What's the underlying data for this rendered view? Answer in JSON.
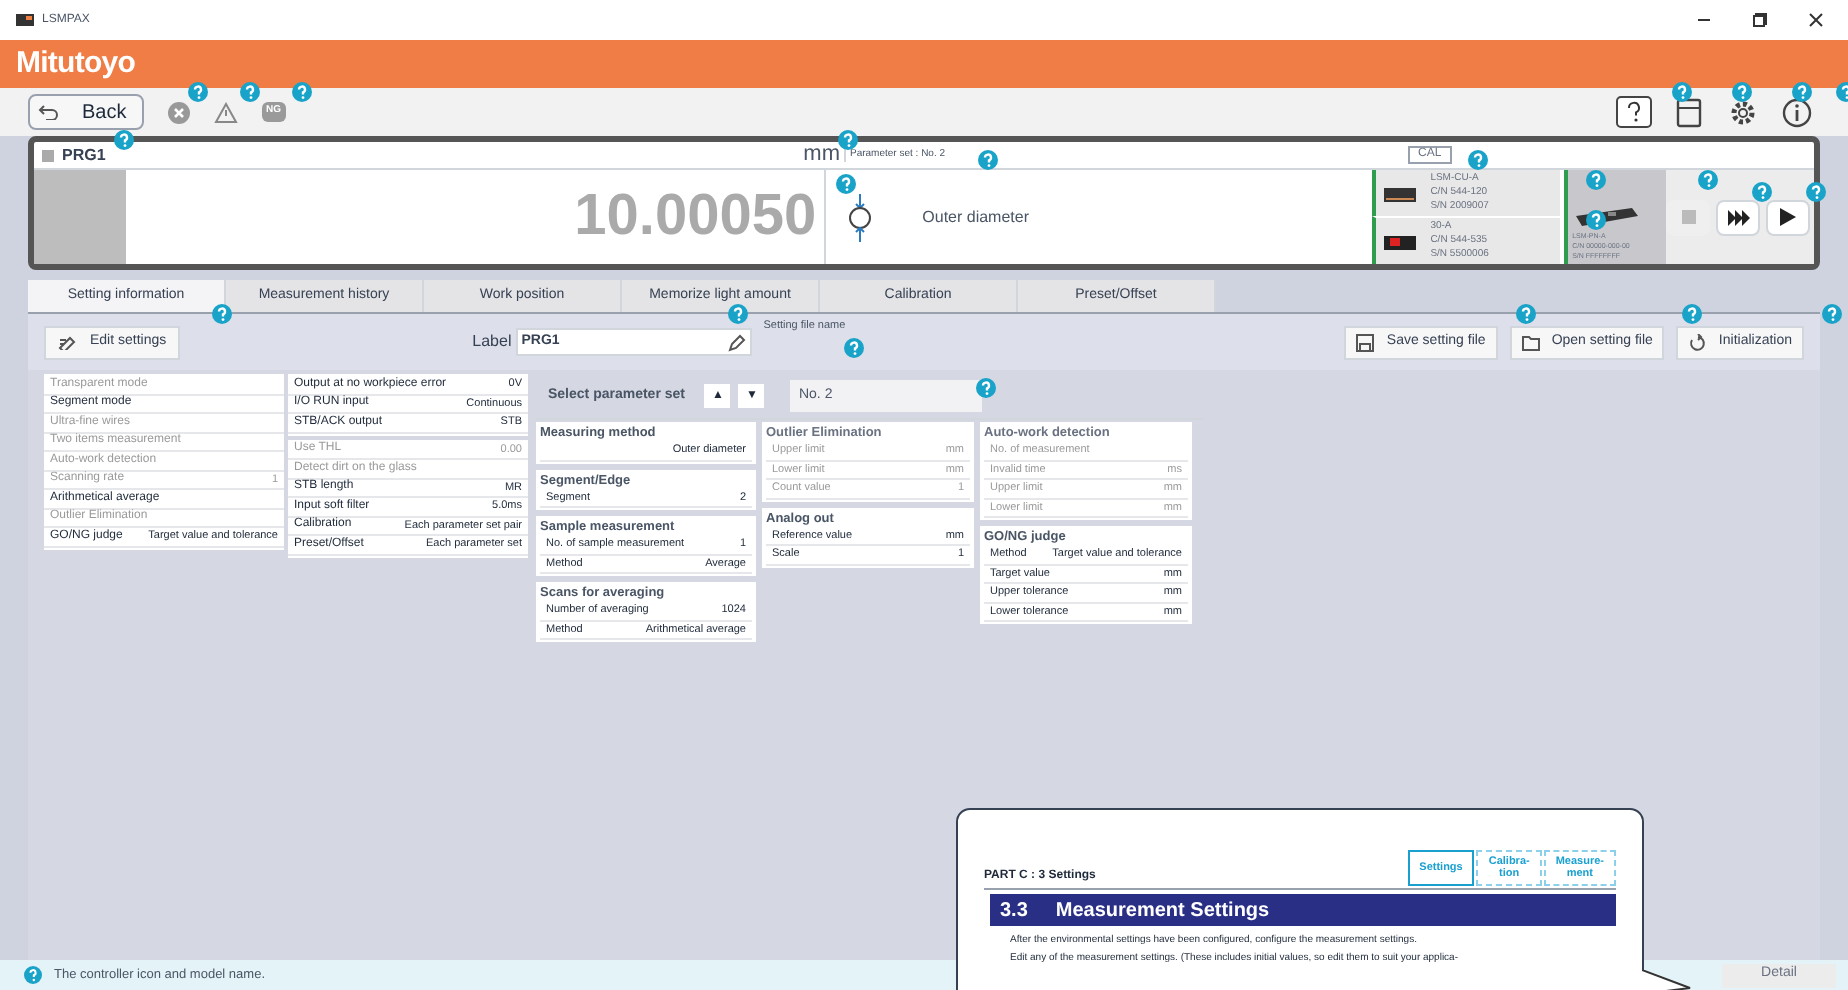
{
  "window": {
    "title": "LSMPAX"
  },
  "header": {
    "logo": "Mitutoyo"
  },
  "toolbar": {
    "back": "Back",
    "ng_badge": "NG"
  },
  "display": {
    "program": "PRG1",
    "unit": "mm",
    "parameter_set": "Parameter set : No. 2",
    "value": "10.00050",
    "method": "Outer diameter",
    "cal": "CAL",
    "devices": [
      {
        "lines": [
          "LSM-CU-A",
          "C/N 544-120",
          "S/N 2009007"
        ]
      },
      {
        "lines": [
          "30-A",
          "C/N 544-535",
          "S/N 5500006"
        ]
      }
    ],
    "head": {
      "lines": [
        "LSM-PN-A",
        "C/N 00000-000-00",
        "S/N FFFFFFFF"
      ]
    }
  },
  "tabs": [
    {
      "label": "Setting information",
      "selected": true
    },
    {
      "label": "Measurement history",
      "selected": false
    },
    {
      "label": "Work position",
      "selected": false
    },
    {
      "label": "Memorize light amount",
      "selected": false
    },
    {
      "label": "Calibration",
      "selected": false
    },
    {
      "label": "Preset/Offset",
      "selected": false
    }
  ],
  "actions": {
    "edit": "Edit settings",
    "label_caption": "Label",
    "label_value": "PRG1",
    "file_name_caption": "Setting file name",
    "buttons": [
      "Save setting file",
      "Open setting file",
      "Initialization"
    ]
  },
  "mode_panel": [
    {
      "label": "Transparent mode",
      "disabled": true
    },
    {
      "label": "Segment mode",
      "disabled": false
    },
    {
      "label": "Ultra-fine wires",
      "disabled": true
    },
    {
      "label": "Two items measurement",
      "disabled": true
    },
    {
      "label": "Auto-work detection",
      "disabled": true
    },
    {
      "label": "Scanning rate",
      "value": "1",
      "disabled": true
    },
    {
      "label": "Arithmetical average",
      "disabled": false
    },
    {
      "label": "Outlier Elimination",
      "disabled": true
    },
    {
      "label": "GO/NG judge",
      "value": "Target value and tolerance",
      "disabled": false
    }
  ],
  "io_panel": [
    {
      "label": "Output at no workpiece error",
      "value": "0V",
      "disabled": false
    },
    {
      "label": "I/O RUN input",
      "value": "Continuous",
      "disabled": false
    },
    {
      "label": "STB/ACK output",
      "value": "STB",
      "disabled": false
    }
  ],
  "threshold_panel": [
    {
      "label": "Use THL",
      "value": "0.00",
      "disabled": true
    },
    {
      "label": "Detect dirt on the glass",
      "disabled": true
    },
    {
      "label": "STB length",
      "value": "MR",
      "disabled": false
    },
    {
      "label": "Input soft filter",
      "value": "5.0ms",
      "disabled": false
    },
    {
      "label": "Calibration",
      "value": "Each parameter set pair",
      "disabled": false
    },
    {
      "label": "Preset/Offset",
      "value": "Each parameter set",
      "disabled": false
    }
  ],
  "parameter_set": {
    "caption": "Select parameter set",
    "up": "▲",
    "down": "▼",
    "value": "No. 2"
  },
  "columns": [
    [
      {
        "title": "Measuring method",
        "rows": [
          {
            "value": "Outer diameter",
            "disabled": false
          }
        ]
      },
      {
        "title": "Segment/Edge",
        "rows": [
          {
            "label": "Segment",
            "value": "2",
            "disabled": false
          }
        ]
      },
      {
        "title": "Sample measurement",
        "rows": [
          {
            "label": "No. of sample measurement",
            "value": "1",
            "disabled": false
          },
          {
            "label": "Method",
            "value": "Average",
            "disabled": false
          }
        ]
      },
      {
        "title": "Scans for averaging",
        "rows": [
          {
            "label": "Number of averaging",
            "value": "1024",
            "disabled": false
          },
          {
            "label": "Method",
            "value": "Arithmetical average",
            "disabled": false
          }
        ]
      }
    ],
    [
      {
        "title": "Outlier Elimination",
        "rows": [
          {
            "label": "Upper limit",
            "value": "mm",
            "disabled": true
          },
          {
            "label": "Lower limit",
            "value": "mm",
            "disabled": true
          },
          {
            "label": "Count value",
            "value": "1",
            "disabled": true
          }
        ]
      },
      {
        "title": "Analog out",
        "rows": [
          {
            "label": "Reference value",
            "value": "mm",
            "disabled": false
          },
          {
            "label": "Scale",
            "value": "1",
            "disabled": false
          }
        ]
      }
    ],
    [
      {
        "title": "Auto-work detection",
        "rows": [
          {
            "label": "No. of measurement",
            "disabled": true
          },
          {
            "label": "Invalid time",
            "value": "ms",
            "disabled": true
          },
          {
            "label": "Upper limit",
            "value": "mm",
            "disabled": true
          },
          {
            "label": "Lower limit",
            "value": "mm",
            "disabled": true
          }
        ]
      },
      {
        "title": "GO/NG judge",
        "rows": [
          {
            "label": "Method",
            "value": "Target value and tolerance",
            "disabled": false
          },
          {
            "label": "Target value",
            "value": "mm",
            "disabled": false
          },
          {
            "label": "Upper tolerance",
            "value": "mm",
            "disabled": false
          },
          {
            "label": "Lower tolerance",
            "value": "mm",
            "disabled": false
          }
        ]
      }
    ]
  ],
  "popup": {
    "header": "PART C : 3 Settings",
    "steps": [
      {
        "label": "Settings",
        "selected": true
      },
      {
        "label": "Calibra-\ntion",
        "selected": false
      },
      {
        "label": "Measure-\nment",
        "selected": false
      }
    ],
    "number": "3.3",
    "heading": "Measurement Settings",
    "lines": [
      "After the environmental settings have been configured, configure the measurement settings.",
      "Edit any of the measurement settings. (These includes initial values, so edit them to suit your applica-"
    ]
  },
  "status_bar": {
    "message": "The controller icon and model name.",
    "detail": "Detail"
  }
}
